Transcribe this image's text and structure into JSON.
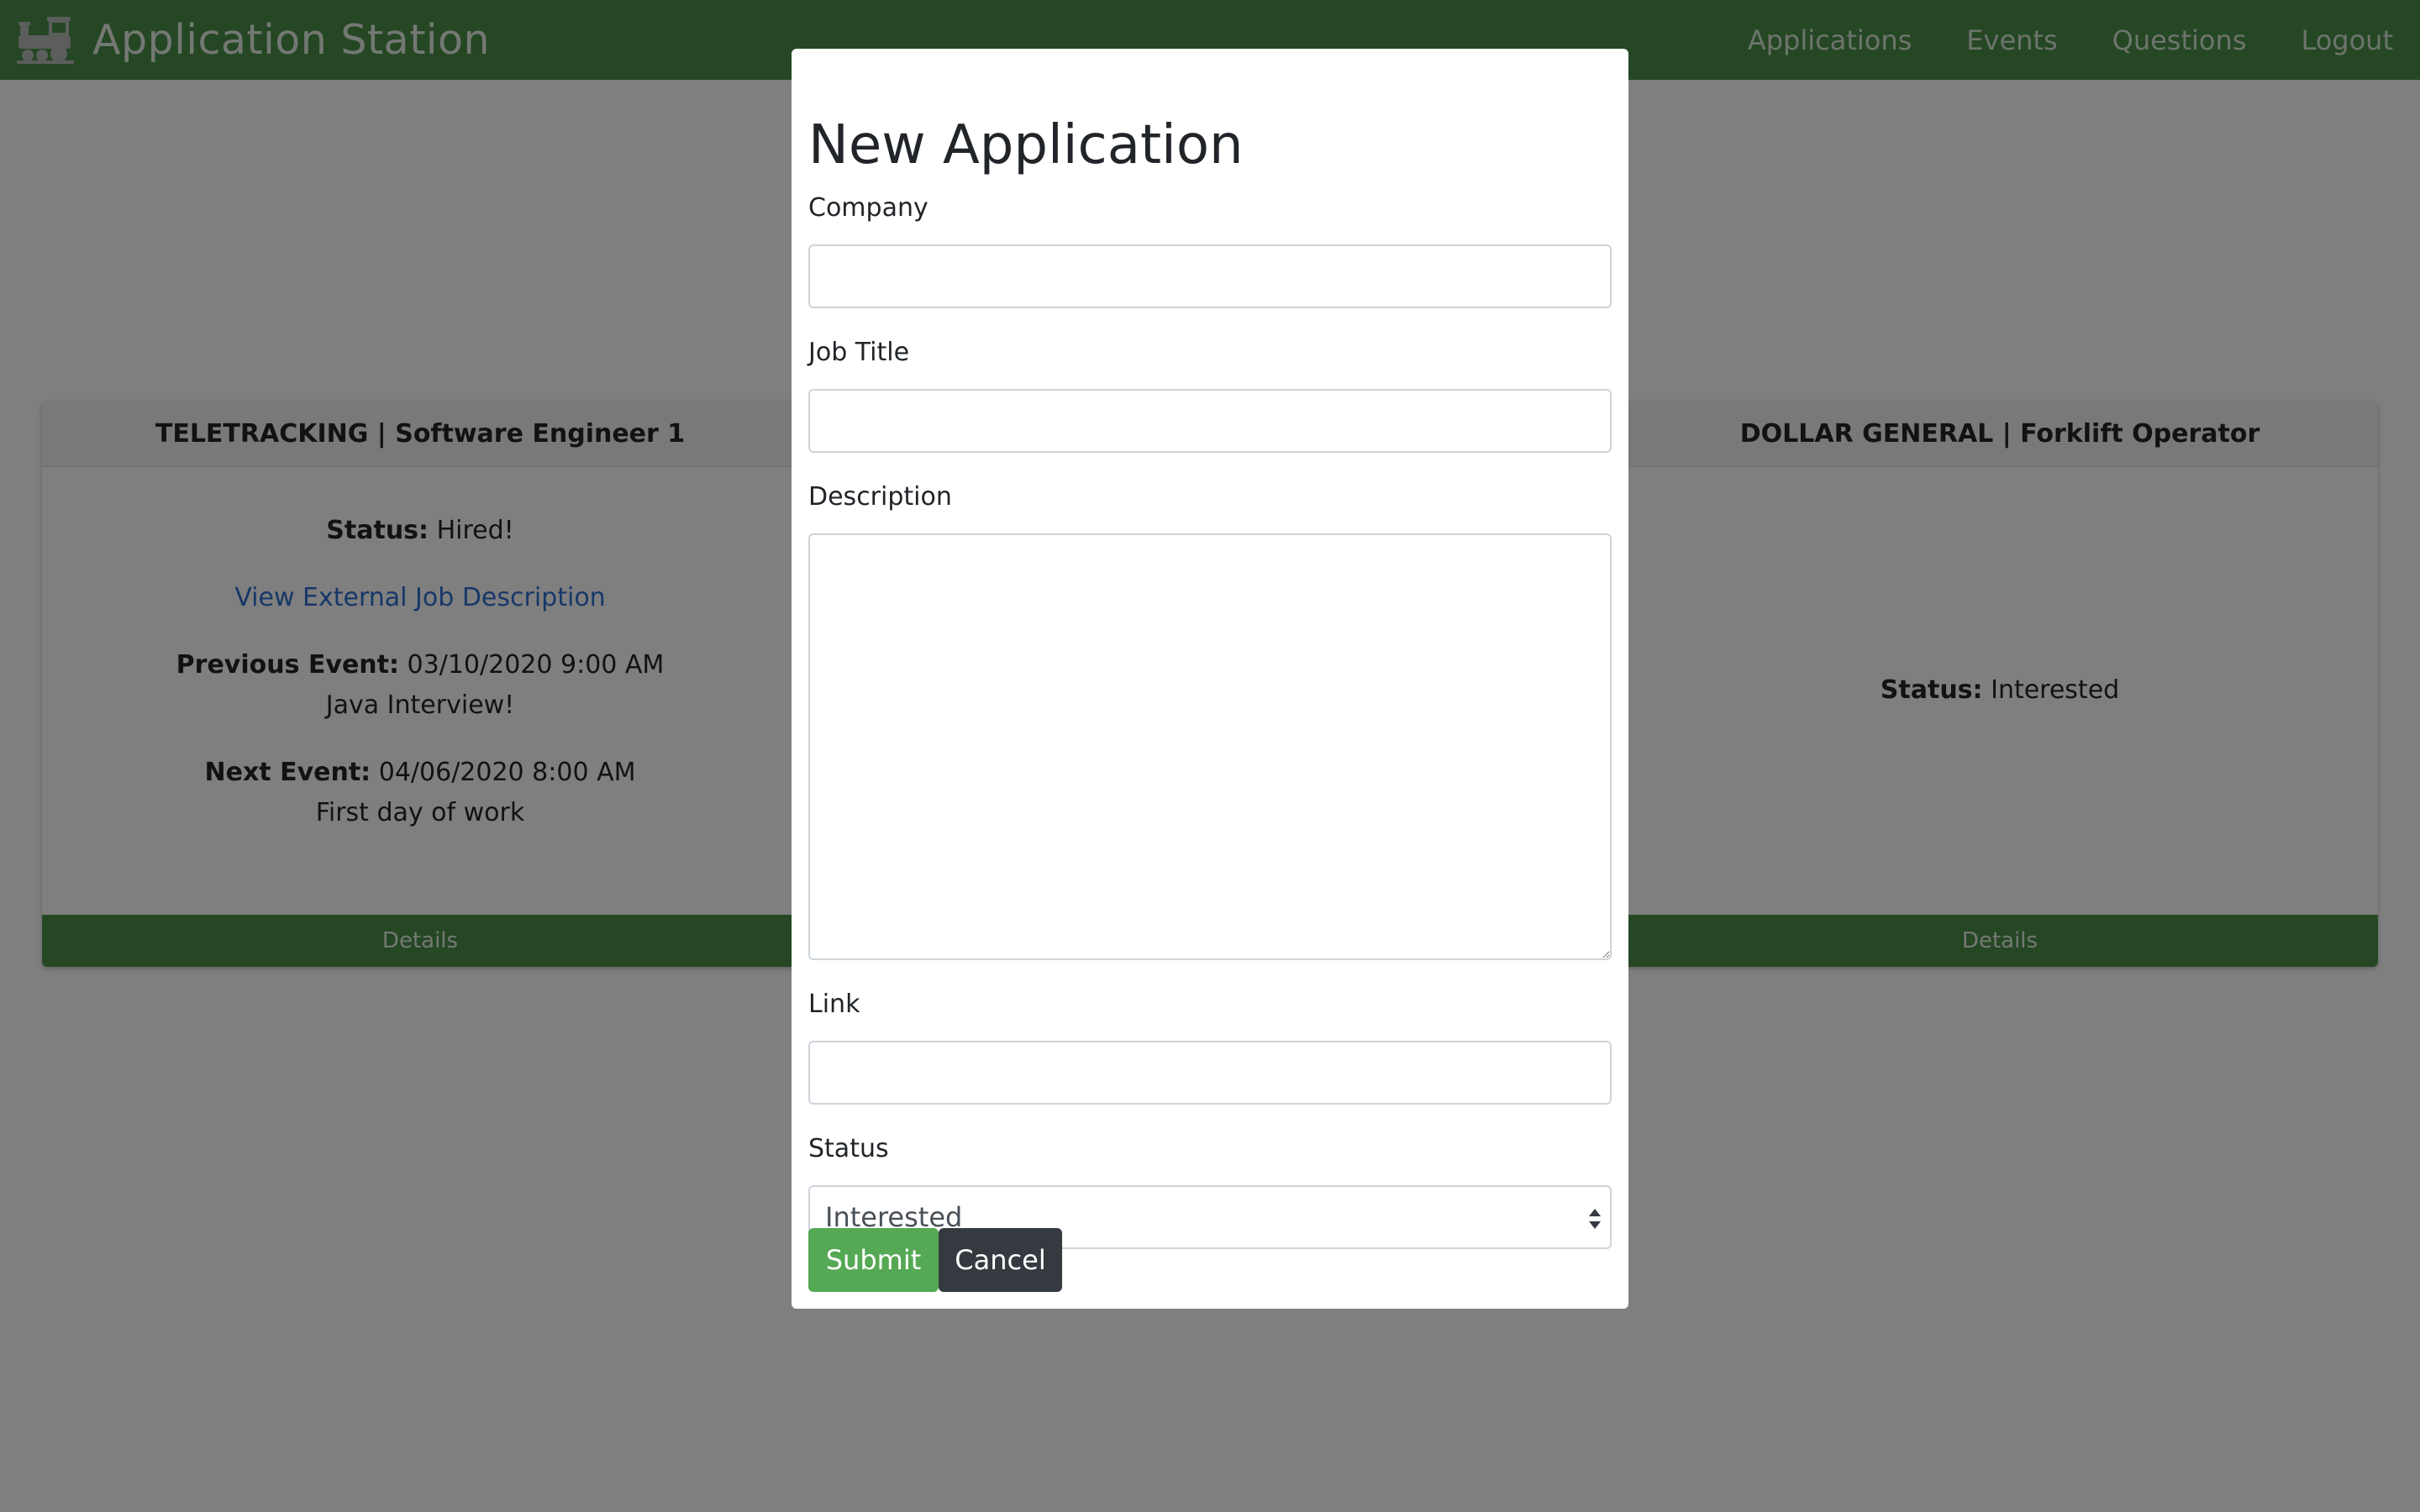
{
  "navbar": {
    "brand": "Application Station",
    "brand_icon": "train-icon",
    "links": [
      "Applications",
      "Events",
      "Questions",
      "Logout"
    ]
  },
  "cards": [
    {
      "header": "TELETRACKING | Software Engineer 1",
      "status_label": "Status:",
      "status_value": "Hired!",
      "link_text": "View External Job Description",
      "prev_event_label": "Previous Event:",
      "prev_event_time": "03/10/2020 9:00 AM",
      "prev_event_title": "Java Interview!",
      "next_event_label": "Next Event:",
      "next_event_time": "04/06/2020 8:00 AM",
      "next_event_title": "First day of work",
      "footer": "Details"
    },
    {
      "header": "DOLLAR GENERAL | Forklift Operator",
      "status_label": "Status:",
      "status_value": "Interested",
      "footer": "Details"
    }
  ],
  "modal": {
    "title": "New Application",
    "company_label": "Company",
    "company_value": "",
    "job_title_label": "Job Title",
    "job_title_value": "",
    "description_label": "Description",
    "description_value": "",
    "link_label": "Link",
    "link_value": "",
    "status_label": "Status",
    "status_value": "Interested",
    "submit_label": "Submit",
    "cancel_label": "Cancel"
  },
  "colors": {
    "navbar": "#4b8e48",
    "submit_button": "#55a854",
    "cancel_button": "#343a40",
    "link": "#2f6fd0",
    "backdrop": "rgba(0,0,0,0.5)"
  }
}
